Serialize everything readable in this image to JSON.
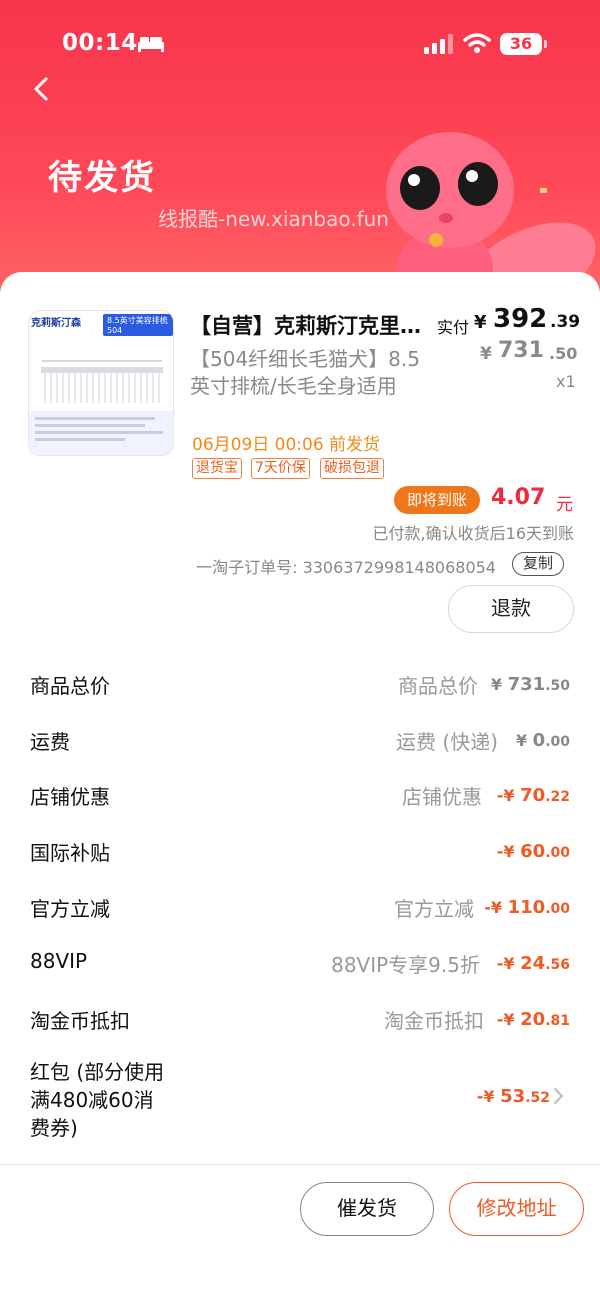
{
  "status_bar": {
    "time": "00:14",
    "battery": "36"
  },
  "header": {
    "title": "待发货",
    "watermark": "线报酷-new.xianbao.fun"
  },
  "product": {
    "thumb_brand": "克莉斯汀森",
    "thumb_model": "8.5英寸美容排梳504",
    "title": "【自营】克莉斯汀克里斯汀森美容排梳",
    "sku": "【504纤细长毛猫犬】8.5英寸排梳/长毛全身适用",
    "paid_label": "实付",
    "paid_yen": "¥",
    "paid_int": "392",
    "paid_dec": ".39",
    "orig_yen": "¥",
    "orig_int": "731",
    "orig_dec": ".50",
    "qty": "x1",
    "ship_note": "06月09日 00:06 前发货",
    "tags": [
      "退货宝",
      "7天价保",
      "破损包退"
    ]
  },
  "settlement": {
    "pill": "即将到账",
    "amount": "4.07",
    "unit": "元",
    "note": "已付款,确认收货后16天到账"
  },
  "order": {
    "number": "一淘子订单号: 3306372998148068054",
    "copy_label": "复制"
  },
  "refund_label": "退款",
  "breakdown": [
    {
      "label": "商品总价",
      "desc": "商品总价",
      "prefix": "¥ ",
      "int": "731",
      "dec": ".50",
      "color": "gray"
    },
    {
      "label": "运费",
      "desc": "运费 (快递)",
      "prefix": "¥ ",
      "int": "0",
      "dec": ".00",
      "color": "gray"
    },
    {
      "label": "店铺优惠",
      "desc": "店铺优惠",
      "prefix": "-¥ ",
      "int": "70",
      "dec": ".22",
      "color": "orange"
    },
    {
      "label": "国际补贴",
      "desc": "",
      "prefix": "-¥ ",
      "int": "60",
      "dec": ".00",
      "color": "orange"
    },
    {
      "label": "官方立减",
      "desc": "官方立减",
      "prefix": "-¥ ",
      "int": "110",
      "dec": ".00",
      "color": "orange"
    },
    {
      "label": "88VIP",
      "desc": "88VIP专享9.5折",
      "prefix": "-¥ ",
      "int": "24",
      "dec": ".56",
      "color": "orange"
    },
    {
      "label": "淘金币抵扣",
      "desc": "淘金币抵扣",
      "prefix": "-¥ ",
      "int": "20",
      "dec": ".81",
      "color": "orange"
    }
  ],
  "hongbao": {
    "label": "红包 (部分使用满480减60消费券)",
    "prefix": "-¥ ",
    "int": "53",
    "dec": ".52"
  },
  "actions": {
    "urge": "催发货",
    "change_address": "修改地址"
  }
}
